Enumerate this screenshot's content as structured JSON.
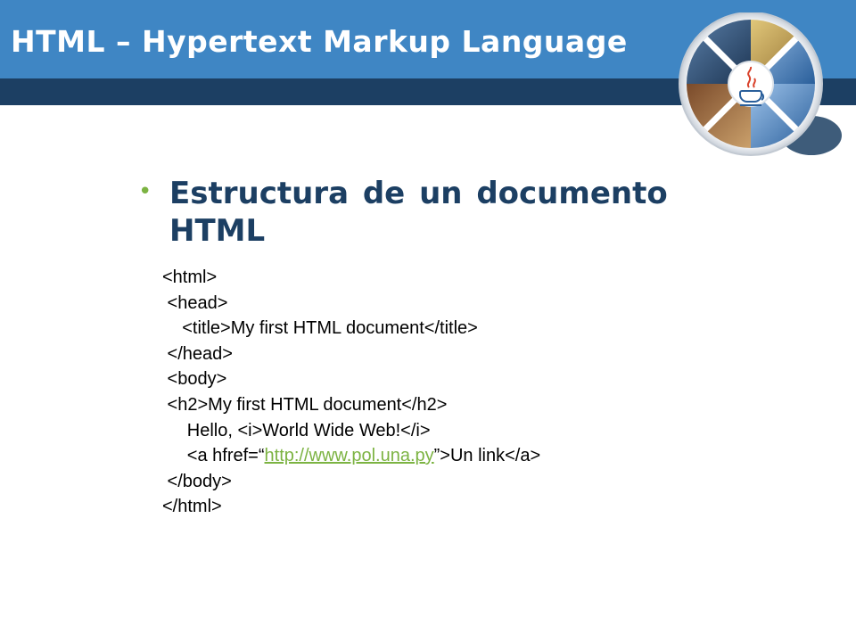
{
  "header": {
    "title": "HTML – Hypertext Markup Language",
    "colors": {
      "top": "#3f86c4",
      "band": "#1c3f63"
    }
  },
  "logo": {
    "icon": "java-coffee-cup-icon"
  },
  "content": {
    "bullet_text": "Estructura de un documento HTML",
    "bullet_color": "#7cb342",
    "code_lines": [
      {
        "indent": "",
        "text": "<html>"
      },
      {
        "indent": " ",
        "text": "<head>"
      },
      {
        "indent": "    ",
        "text": "<title>My first HTML document</title>"
      },
      {
        "indent": " ",
        "text": "</head>"
      },
      {
        "indent": " ",
        "text": "<body>"
      },
      {
        "indent": " ",
        "text": "<h2>My first HTML document</h2>"
      },
      {
        "indent": "     ",
        "text": "Hello, <i>World Wide Web!</i>"
      },
      {
        "indent": "     ",
        "pre": "<a hfref=“",
        "link": "http://www.pol.una.py",
        "post": "”>Un link</a>"
      },
      {
        "indent": " ",
        "text": "</body>"
      },
      {
        "indent": "",
        "text": "</html>"
      }
    ]
  }
}
